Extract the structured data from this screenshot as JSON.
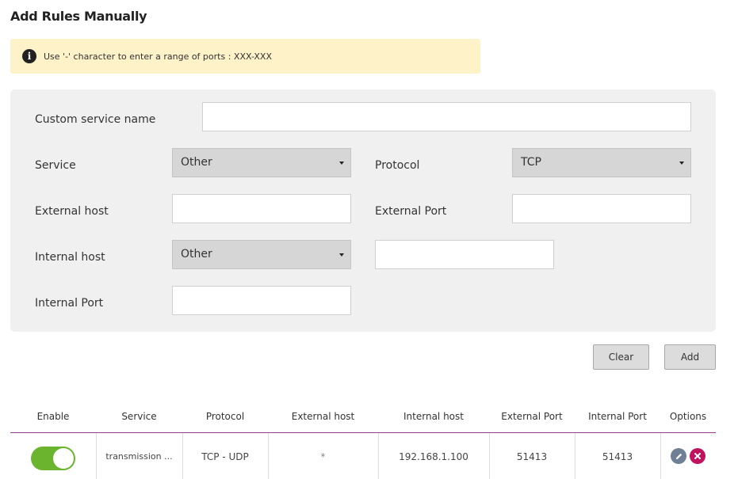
{
  "title": "Add Rules Manually",
  "info": {
    "text": "Use '-' character to enter a range of ports : XXX-XXX",
    "icon": "info-icon"
  },
  "form": {
    "custom_service_name_label": "Custom service name",
    "custom_service_name_value": "",
    "service_label": "Service",
    "service_value": "Other",
    "protocol_label": "Protocol",
    "protocol_value": "TCP",
    "external_host_label": "External host",
    "external_host_value": "",
    "external_port_label": "External Port",
    "external_port_value": "",
    "internal_host_label": "Internal host",
    "internal_host_select": "Other",
    "internal_host_value": "",
    "internal_port_label": "Internal Port",
    "internal_port_value": ""
  },
  "buttons": {
    "clear": "Clear",
    "add": "Add"
  },
  "table": {
    "headers": {
      "enable": "Enable",
      "service": "Service",
      "protocol": "Protocol",
      "external_host": "External host",
      "internal_host": "Internal host",
      "external_port": "External Port",
      "internal_port": "Internal Port",
      "options": "Options"
    },
    "rows": [
      {
        "enabled": true,
        "service": "transmission ...",
        "protocol": "TCP - UDP",
        "external_host": "*",
        "internal_host": "192.168.1.100",
        "external_port": "51413",
        "internal_port": "51413"
      }
    ]
  },
  "colors": {
    "toggle_on": "#6bb42d",
    "header_line": "#9b3b8a",
    "edit_button": "#6f7f96",
    "delete_button": "#c0135e",
    "info_bg": "#fdf2c8"
  }
}
